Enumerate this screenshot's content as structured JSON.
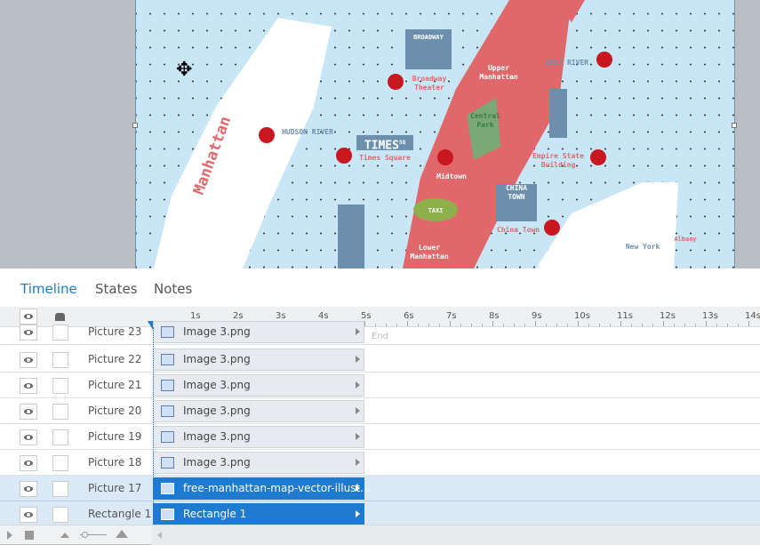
{
  "map": {
    "labels": {
      "manhattan": "Manhattan",
      "upper": "Upper Manhattan",
      "broadway_sign": "BROADWAY",
      "broadway": "Broadway Theater",
      "east_river": "EAST RIVER",
      "hudson": "HUDSON RIVER",
      "times_sign": "TIMES",
      "times_sq": "SQ",
      "times": "Times Square",
      "central": "Central Park",
      "midtown": "Midtown",
      "empire": "Empire State Building",
      "china_sign": "CHINA TOWN",
      "china": "China Town",
      "taxi": "TAXI",
      "lower": "Lower Manhattan",
      "new_york": "New York",
      "albany": "Albany"
    }
  },
  "tabs": [
    "Timeline",
    "States",
    "Notes"
  ],
  "ruler": [
    "1s",
    "2s",
    "3s",
    "4s",
    "5s",
    "6s",
    "7s",
    "8s",
    "9s",
    "10s",
    "11s",
    "12s",
    "13s",
    "14s"
  ],
  "end_label": "End",
  "rows": [
    {
      "name": "Picture 23",
      "bar": "Image 3.png"
    },
    {
      "name": "Picture 22",
      "bar": "Image 3.png"
    },
    {
      "name": "Picture 21",
      "bar": "Image 3.png"
    },
    {
      "name": "Picture 20",
      "bar": "Image 3.png"
    },
    {
      "name": "Picture 19",
      "bar": "Image 3.png"
    },
    {
      "name": "Picture 18",
      "bar": "Image 3.png"
    },
    {
      "name": "Picture 17",
      "bar": "free-manhattan-map-vector-illust..."
    },
    {
      "name": "Rectangle 1",
      "bar": "Rectangle 1"
    }
  ]
}
